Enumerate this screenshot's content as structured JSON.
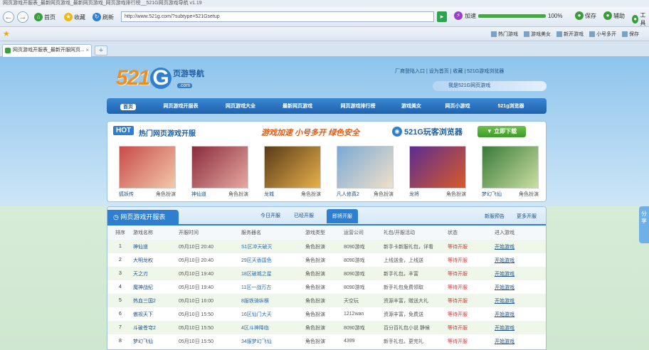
{
  "window": {
    "title": "网页游戏开服表_最新网页游戏_最新网页游戏_网页游戏排行榜__521G网页游戏导航  v1.19"
  },
  "toolbar": {
    "back": "←",
    "forward": "→",
    "home_label": "首页",
    "favorites_label": "收藏",
    "refresh_label": "刷新",
    "address": "http://www.521g.com/?subtype=521Gsetup",
    "go": "▸",
    "speed_label": "加速",
    "speed_value": "100%",
    "right_buttons": [
      "保存",
      "辅助",
      "工具"
    ]
  },
  "favbar": {
    "items": [
      "热门游戏",
      "游戏美女",
      "新开游戏",
      "小号多开",
      "保存"
    ]
  },
  "tabs": [
    {
      "label": "网页游戏开服表_最新开服网页..."
    }
  ],
  "site": {
    "logo_num": "521",
    "logo_g": "G",
    "logo_sub": "页游导航",
    "logo_com": ".com",
    "top_links": "厂商登陆入口  |  设为首页  |  收藏  |  521G游戏浏览器",
    "promo": "我是521G网页游戏"
  },
  "nav": [
    "首页",
    "网页游戏开服表",
    "网页游戏大全",
    "最新网页游戏",
    "网页游戏排行榜",
    "游戏美女",
    "网页小游戏",
    "521g浏览器"
  ],
  "hot": {
    "label": "HOT",
    "title": "热门网页游戏开服",
    "slogan": "游戏加速  小号多开  绿色安全",
    "brand": "521G玩客浏览器",
    "download": "立即下载",
    "games": [
      {
        "name": "狐妖传",
        "type": "角色扮演",
        "colors": [
          "#c94a4a",
          "#f2c9a8"
        ]
      },
      {
        "name": "神仙道",
        "type": "角色扮演",
        "colors": [
          "#8a2c3d",
          "#e8a8a0"
        ]
      },
      {
        "name": "龙城",
        "type": "角色扮演",
        "colors": [
          "#5a3a1a",
          "#e6b24a"
        ]
      },
      {
        "name": "凡人修真2",
        "type": "角色扮演",
        "colors": [
          "#7aa9d6",
          "#f0e0c8"
        ]
      },
      {
        "name": "龙将",
        "type": "角色扮演",
        "colors": [
          "#5b2d8f",
          "#d95a2a"
        ]
      },
      {
        "name": "梦幻飞仙",
        "type": "角色扮演",
        "colors": [
          "#3a7a3a",
          "#c9e0a0"
        ]
      }
    ]
  },
  "servers": {
    "title": "网页游戏开服表",
    "tabs": [
      "今日开服",
      "已经开服",
      "即将开服"
    ],
    "active_tab": 2,
    "right_links": [
      "新服预告",
      "更多开服"
    ],
    "headers": [
      "排序",
      "游戏名称",
      "开服时间",
      "服务器名",
      "游戏类型",
      "运营公司",
      "礼包/开服活动",
      "状态",
      "进入游戏"
    ],
    "rows": [
      [
        "1",
        "神仙道",
        "05月10日 20:40",
        "S1区冲天破灭",
        "角色扮演",
        "8090游戏",
        "新手卡新服礼包，详看",
        "等待开服",
        "开始游戏"
      ],
      [
        "2",
        "大明龙权",
        "05月10日 20:40",
        "29区天香国色",
        "角色扮演",
        "8090游戏",
        "上线送金，上线送",
        "等待开服",
        "开始游戏"
      ],
      [
        "3",
        "天之刃",
        "05月10日 19:40",
        "18区破城之星",
        "角色扮演",
        "8090游戏",
        "新手礼包，丰富",
        "等待开服",
        "开始游戏"
      ],
      [
        "4",
        "魔神战纪",
        "05月10日 19:40",
        "11区一战万古",
        "角色扮演",
        "8090游戏",
        "新手礼包免费领取",
        "等待开服",
        "开始游戏"
      ],
      [
        "5",
        "热血三国2",
        "05月10日 16:00",
        "8服铁骑纵横",
        "角色扮演",
        "天空玩",
        "资源丰富，赠送大礼",
        "等待开服",
        "开始游戏"
      ],
      [
        "6",
        "傲视天下",
        "05月10日 15:50",
        "16区仙门大天",
        "角色扮演",
        "1212wan",
        "资源丰富，免费送",
        "等待开服",
        "开始游戏"
      ],
      [
        "7",
        "斗破苍穹2",
        "05月10日 15:50",
        "4区斗神降临",
        "角色扮演",
        "8090游戏",
        "百分百礼包小说 静候",
        "等待开服",
        "开始游戏"
      ],
      [
        "8",
        "梦幻飞仙",
        "05月10日 15:50",
        "34服梦幻飞仙",
        "角色扮演",
        "4399",
        "新手礼包，更完礼",
        "等待开服",
        "开始游戏"
      ]
    ]
  },
  "sidetab": "分享"
}
